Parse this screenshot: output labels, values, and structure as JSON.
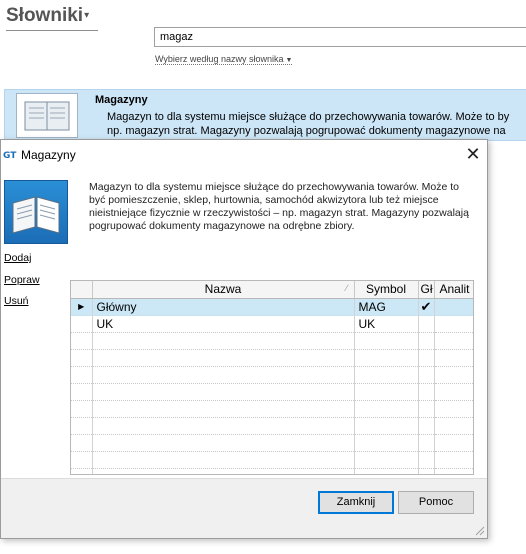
{
  "background": {
    "title": "Słowniki",
    "search_value": "magaz",
    "hint": "Wybierz według nazwy słownika",
    "card": {
      "title": "Magazyny",
      "line1": "Magazyn to dla systemu miejsce służące do przechowywania towarów. Może to by",
      "line2": "np. magazyn strat. Magazyny pozwalają pogrupować dokumenty magazynowe na"
    }
  },
  "dialog": {
    "title": "Magazyny",
    "close_glyph": "✕",
    "description": "Magazyn to dla systemu miejsce służące do przechowywania towarów. Może to być pomieszczenie, sklep, hurtownia, samochód akwizytora lub też miejsce nieistniejące fizycznie w rzeczywistości – np. magazyn strat. Magazyny pozwalają pogrupować dokumenty magazynowe na odrębne zbiory.",
    "side_links": {
      "add": "Dodaj",
      "edit": "Popraw",
      "delete": "Usuń"
    },
    "grid": {
      "columns": {
        "name": "Nazwa",
        "symbol": "Symbol",
        "main": "Gł",
        "analytic": "Analit"
      },
      "rows": [
        {
          "name": "Główny",
          "symbol": "MAG",
          "main_checked": true,
          "selected": true
        },
        {
          "name": "UK",
          "symbol": "UK",
          "main_checked": false,
          "selected": false
        }
      ],
      "empty_rows": 9,
      "selected_color": "#cce8f7"
    },
    "buttons": {
      "close": "Zamknij",
      "help": "Pomoc"
    },
    "colors": {
      "accent": "#0078d7",
      "card_bg": "#cde6f7"
    }
  }
}
